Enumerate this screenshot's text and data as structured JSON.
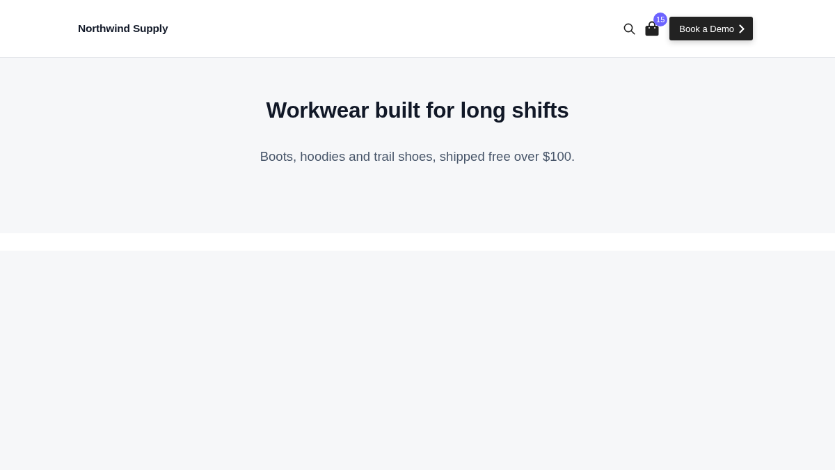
{
  "header": {
    "logo": "Northwind Supply",
    "cart_count": "15",
    "cta": "Book a Demo"
  },
  "hero": {
    "title": "Workwear built for long shifts",
    "subtitle": "Boots, hoodies and trail shoes, shipped free over $100."
  }
}
